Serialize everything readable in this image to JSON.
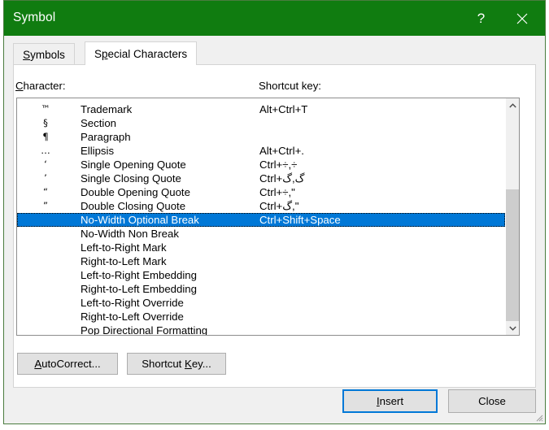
{
  "window": {
    "title": "Symbol",
    "title_bar_color": "#107c10",
    "help_label": "?",
    "close_label": "✕"
  },
  "tabs": [
    {
      "label": "Symbols",
      "accel": "S",
      "active": false,
      "name": "tab-symbols"
    },
    {
      "label": "Special Characters",
      "accel": "p",
      "active": true,
      "name": "tab-special-characters"
    }
  ],
  "labels": {
    "character": "Character:",
    "character_accel": "C",
    "shortcut_key": "Shortcut key:"
  },
  "list": {
    "selected_index": 8,
    "selection_color": "#0078d7",
    "visible_rows": 17,
    "rows": [
      {
        "glyph": "™",
        "name": "Trademark",
        "key": "Alt+Ctrl+T"
      },
      {
        "glyph": "§",
        "name": "Section",
        "key": ""
      },
      {
        "glyph": "¶",
        "name": "Paragraph",
        "key": ""
      },
      {
        "glyph": "…",
        "name": "Ellipsis",
        "key": "Alt+Ctrl+."
      },
      {
        "glyph": "‘",
        "name": "Single Opening Quote",
        "key": "Ctrl+÷,÷"
      },
      {
        "glyph": "’",
        "name": "Single Closing Quote",
        "key": "Ctrl+گ,گ"
      },
      {
        "glyph": "“",
        "name": "Double Opening Quote",
        "key": "Ctrl+÷,\""
      },
      {
        "glyph": "”",
        "name": "Double Closing Quote",
        "key": "Ctrl+گ,\""
      },
      {
        "glyph": "",
        "name": "No-Width Optional Break",
        "key": "Ctrl+Shift+Space"
      },
      {
        "glyph": "",
        "name": "No-Width Non Break",
        "key": ""
      },
      {
        "glyph": "",
        "name": "Left-to-Right Mark",
        "key": ""
      },
      {
        "glyph": "",
        "name": "Right-to-Left Mark",
        "key": ""
      },
      {
        "glyph": "",
        "name": "Left-to-Right Embedding",
        "key": ""
      },
      {
        "glyph": "",
        "name": "Right-to-Left Embedding",
        "key": ""
      },
      {
        "glyph": "",
        "name": "Left-to-Right Override",
        "key": ""
      },
      {
        "glyph": "",
        "name": "Right-to-Left Override",
        "key": ""
      },
      {
        "glyph": "",
        "name": "Pop Directional Formatting",
        "key": ""
      }
    ]
  },
  "scrollbar": {
    "up_icon": "chevron-up-icon",
    "down_icon": "chevron-down-icon"
  },
  "buttons": {
    "autocorrect": {
      "label": "AutoCorrect...",
      "accel": "A"
    },
    "shortcut_key": {
      "label": "Shortcut Key...",
      "accel": "K"
    },
    "insert": {
      "label": "Insert",
      "accel": "I",
      "default": true
    },
    "close": {
      "label": "Close",
      "accel": ""
    }
  }
}
